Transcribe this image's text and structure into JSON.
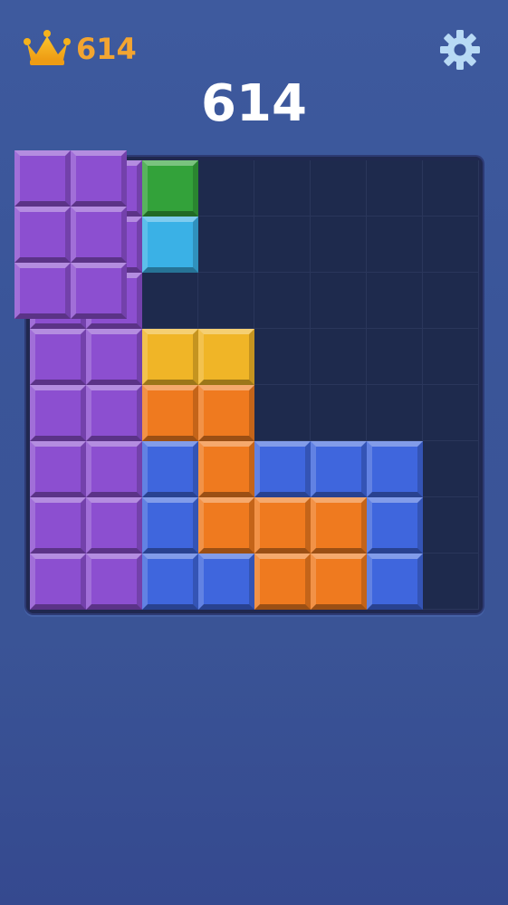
{
  "header": {
    "best_score": "614",
    "current_score": "614",
    "crown_icon": "crown-icon",
    "settings_icon": "gear-icon"
  },
  "colors": {
    "background": "#3b5599",
    "board": "#20284f",
    "empty_cell": "#1e2a4d",
    "best_score_text": "#f3a531",
    "crown": "#f5b21c",
    "gear": "#b8daf5",
    "purple": "#8c4fd0",
    "green": "#33a23a",
    "cyan": "#3ab1e6",
    "yellow": "#f0b527",
    "orange": "#ef7a1f",
    "blue": "#3f66dd"
  },
  "board": {
    "columns": 8,
    "rows": 8,
    "cells": [
      [
        "purple",
        "purple",
        "green",
        "",
        "",
        "",
        "",
        ""
      ],
      [
        "purple",
        "purple",
        "cyan",
        "",
        "",
        "",
        "",
        ""
      ],
      [
        "purple",
        "purple",
        "",
        "",
        "",
        "",
        "",
        ""
      ],
      [
        "purple",
        "purple",
        "yellow",
        "yellow",
        "",
        "",
        "",
        ""
      ],
      [
        "purple",
        "purple",
        "orange",
        "orange",
        "",
        "",
        "",
        ""
      ],
      [
        "purple",
        "purple",
        "blue",
        "orange",
        "blue",
        "blue",
        "blue",
        ""
      ],
      [
        "purple",
        "purple",
        "blue",
        "orange",
        "orange",
        "orange",
        "blue",
        ""
      ],
      [
        "purple",
        "purple",
        "blue",
        "blue",
        "orange",
        "orange",
        "blue",
        ""
      ]
    ]
  },
  "held_piece": {
    "color": "purple",
    "shape": [
      [
        1,
        1
      ],
      [
        1,
        1
      ],
      [
        1,
        1
      ]
    ]
  }
}
